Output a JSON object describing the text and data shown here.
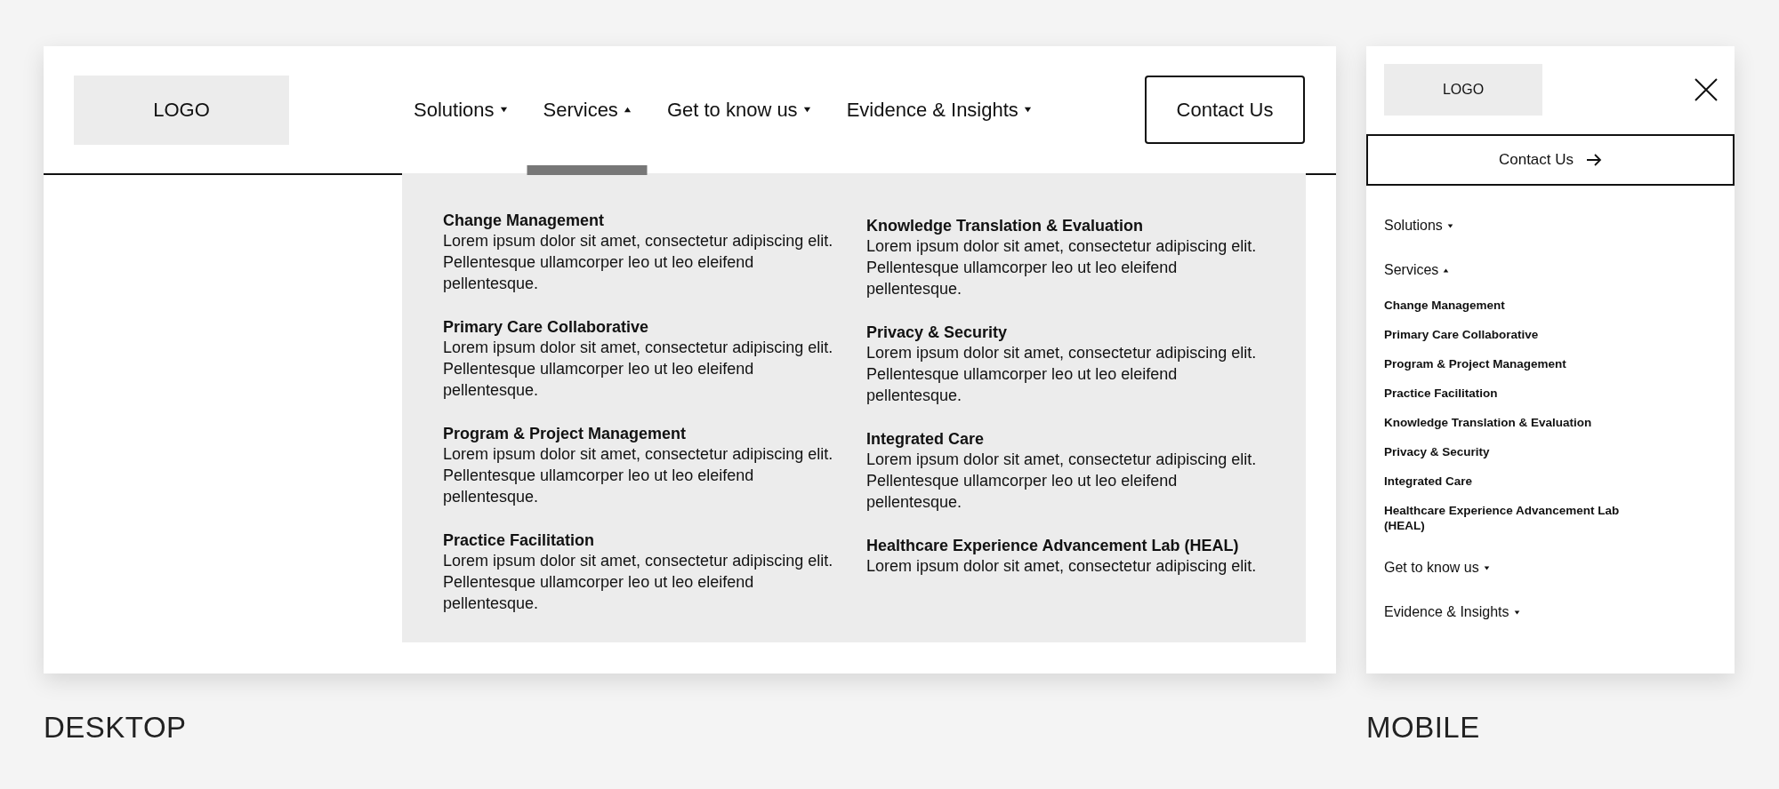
{
  "desktop": {
    "logo": "LOGO",
    "nav": [
      {
        "label": "Solutions",
        "expanded": false
      },
      {
        "label": "Services",
        "expanded": true
      },
      {
        "label": "Get to know us",
        "expanded": false
      },
      {
        "label": "Evidence & Insights",
        "expanded": false
      }
    ],
    "contact_button": "Contact Us",
    "dropdown": {
      "columns": [
        [
          {
            "title": "Change Management",
            "description": "Lorem ipsum dolor sit amet, consectetur adipiscing elit. Pellentesque ullamcorper leo ut leo eleifend pellentesque."
          },
          {
            "title": "Primary Care Collaborative",
            "description": "Lorem ipsum dolor sit amet, consectetur adipiscing elit. Pellentesque ullamcorper leo ut leo eleifend pellentesque."
          },
          {
            "title": "Program & Project Management",
            "description": "Lorem ipsum dolor sit amet, consectetur adipiscing elit. Pellentesque ullamcorper leo ut leo eleifend pellentesque."
          },
          {
            "title": "Practice Facilitation",
            "description": "Lorem ipsum dolor sit amet, consectetur adipiscing elit. Pellentesque ullamcorper leo ut leo eleifend pellentesque."
          }
        ],
        [
          {
            "title": "Knowledge Translation & Evaluation",
            "description": "Lorem ipsum dolor sit amet, consectetur adipiscing elit. Pellentesque ullamcorper leo ut leo eleifend pellentesque."
          },
          {
            "title": "Privacy & Security",
            "description": "Lorem ipsum dolor sit amet, consectetur adipiscing elit. Pellentesque ullamcorper leo ut leo eleifend pellentesque."
          },
          {
            "title": "Integrated Care",
            "description": "Lorem ipsum dolor sit amet, consectetur adipiscing elit. Pellentesque ullamcorper leo ut leo eleifend pellentesque."
          },
          {
            "title": "Healthcare Experience Advancement Lab (HEAL)",
            "description": "Lorem ipsum dolor sit amet, consectetur adipiscing elit."
          }
        ]
      ]
    },
    "caption": "DESKTOP"
  },
  "mobile": {
    "logo": "LOGO",
    "contact_button": "Contact Us",
    "nav": [
      {
        "label": "Solutions",
        "expanded": false
      },
      {
        "label": "Services",
        "expanded": true,
        "children": [
          {
            "label": "Change Management"
          },
          {
            "label": "Primary Care Collaborative"
          },
          {
            "label": "Program & Project Management"
          },
          {
            "label": "Practice Facilitation"
          },
          {
            "label": "Knowledge Translation & Evaluation"
          },
          {
            "label": "Privacy & Security"
          },
          {
            "label": "Integrated Care"
          },
          {
            "label": "Healthcare Experience Advancement Lab (HEAL)"
          }
        ]
      },
      {
        "label": "Get to know us",
        "expanded": false
      },
      {
        "label": "Evidence & Insights",
        "expanded": false
      }
    ],
    "caption": "MOBILE"
  }
}
